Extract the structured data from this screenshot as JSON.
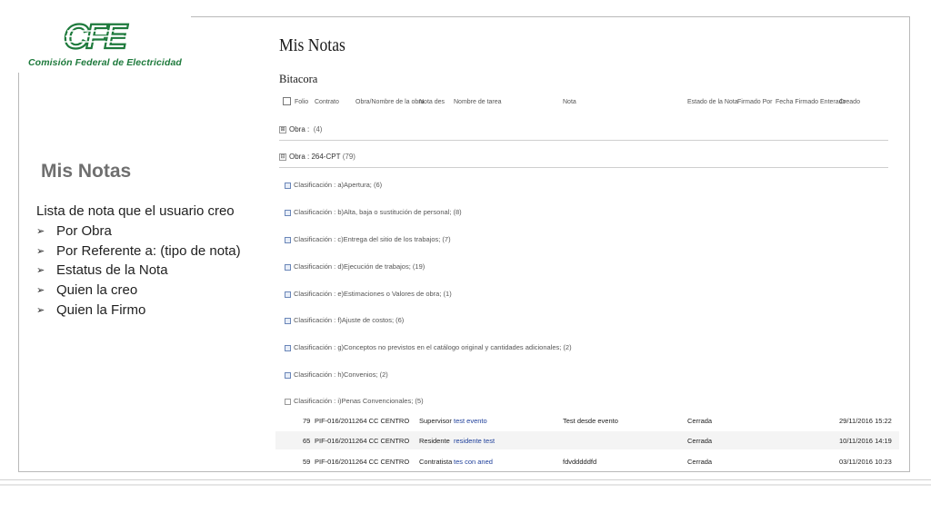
{
  "logo": {
    "mark": "CFE",
    "name": "Comisión Federal de Electricidad",
    "color": "#1e7a3c"
  },
  "slide": {
    "title": "Mis Notas",
    "description": "Lista de nota que el usuario creo",
    "bullets": [
      "Por  Obra",
      "Por Referente a: (tipo de nota)",
      "Estatus de la Nota",
      "Quien la creo",
      "Quien la Firmo"
    ]
  },
  "app": {
    "title": "Mis Notas",
    "subtitle": "Bitacora",
    "headers": [
      "Folio",
      "Contrato",
      "Obra/Nombre de la obra",
      "Nota des",
      "Nombre de tarea",
      "Nota",
      "Estado de la Nota",
      "Firmado Por",
      "Fecha Firmado Enterado",
      "Creado"
    ],
    "groups": [
      {
        "label": "Obra :",
        "count": "(4)"
      },
      {
        "label": "Obra : 264-CPT",
        "count": "(79)"
      }
    ],
    "clasificaciones": [
      "Clasificación : a)Apertura; (6)",
      "Clasificación : b)Alta, baja o sustitución de personal; (8)",
      "Clasificación : c)Entrega del sitio de los trabajos; (7)",
      "Clasificación : d)Ejecución de trabajos; (19)",
      "Clasificación : e)Estimaciones o Valores de obra; (1)",
      "Clasificación : f)Ajuste de costos; (6)",
      "Clasificación : g)Conceptos no previstos en el catálogo original y cantidades adicionales; (2)",
      "Clasificación : h)Convenios; (2)",
      "Clasificación : i)Penas Convencionales; (5)"
    ],
    "rows": [
      {
        "folio": "79",
        "contrato": "PIF-016/2011",
        "obra": "264 CC CENTRO",
        "nota_des": "Supervisor",
        "tarea": "test evento",
        "nota": "Test desde evento",
        "estado": "Cerrada",
        "creado": "29/11/2016 15:22"
      },
      {
        "folio": "65",
        "contrato": "PIF-016/2011",
        "obra": "264 CC CENTRO",
        "nota_des": "Residente",
        "tarea": "residente test",
        "nota": "",
        "estado": "Cerrada",
        "creado": "10/11/2016 14:19"
      },
      {
        "folio": "59",
        "contrato": "PIF-016/2011",
        "obra": "264 CC CENTRO",
        "nota_des": "Contratista",
        "tarea": "tes con aned",
        "nota": "fdvdddddfd",
        "estado": "Cerrada",
        "creado": "03/11/2016 10:23"
      }
    ]
  }
}
